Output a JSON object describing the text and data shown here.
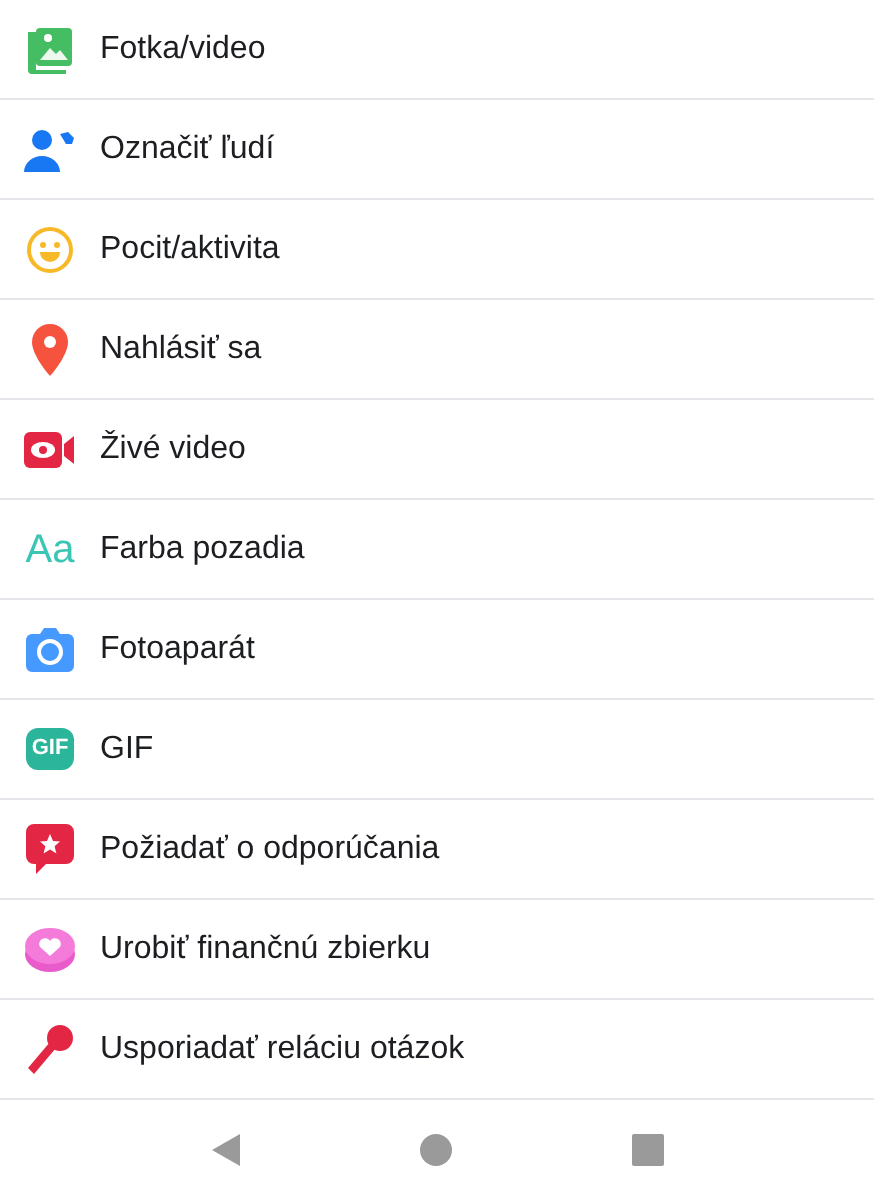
{
  "options": [
    {
      "kind": "photo",
      "label": "Fotka/video"
    },
    {
      "kind": "tag",
      "label": "Označiť ľudí"
    },
    {
      "kind": "feeling",
      "label": "Pocit/aktivita"
    },
    {
      "kind": "checkin",
      "label": "Nahlásiť sa"
    },
    {
      "kind": "live",
      "label": "Živé video"
    },
    {
      "kind": "background",
      "label": "Farba pozadia",
      "icon_text": "Aa"
    },
    {
      "kind": "camera",
      "label": "Fotoaparát"
    },
    {
      "kind": "gif",
      "label": "GIF",
      "icon_text": "GIF"
    },
    {
      "kind": "recommend",
      "label": "Požiadať o odporúčania"
    },
    {
      "kind": "fundraiser",
      "label": "Urobiť finančnú zbierku"
    },
    {
      "kind": "qa",
      "label": "Usporiadať reláciu otázok"
    }
  ]
}
